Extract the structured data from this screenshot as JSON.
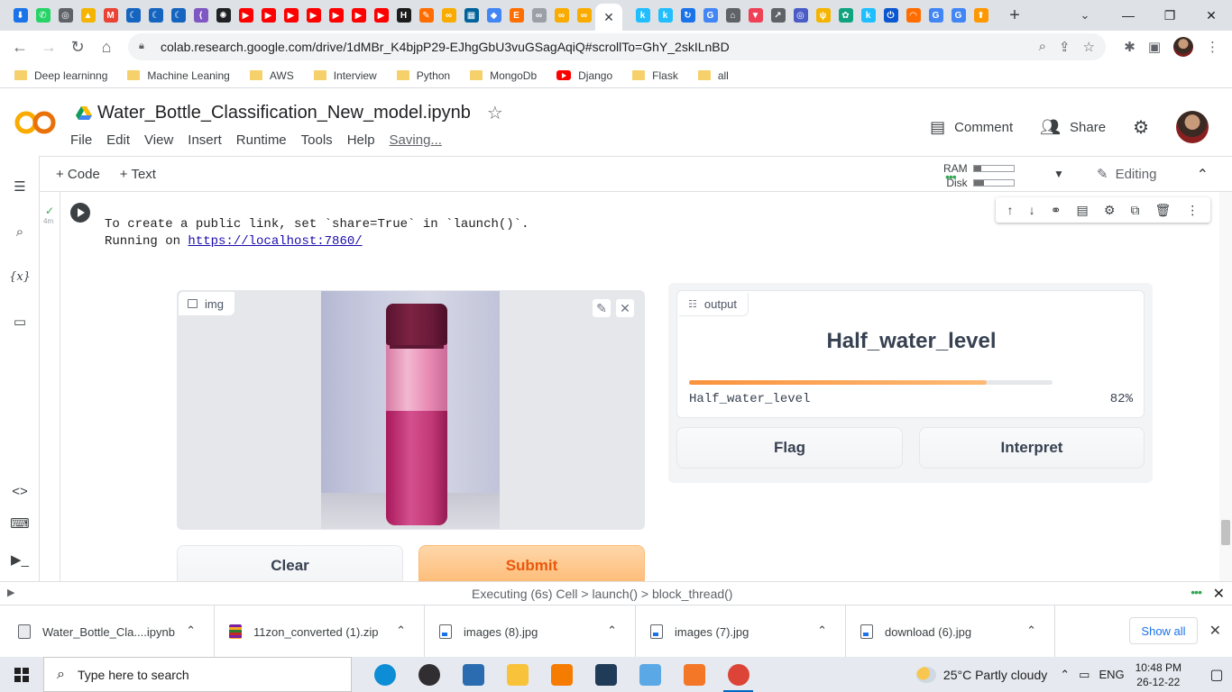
{
  "browser": {
    "tab_favicons": [
      {
        "name": "download-icon",
        "color": "#1a73e8",
        "glyph": "⬇"
      },
      {
        "name": "whatsapp-icon",
        "color": "#25d366",
        "glyph": "✆"
      },
      {
        "name": "globe-icon",
        "color": "#5f6368",
        "glyph": "◎"
      },
      {
        "name": "drive-icon",
        "color": "#f4b400",
        "glyph": "▲"
      },
      {
        "name": "gmail-icon",
        "color": "#ea4335",
        "glyph": "M"
      },
      {
        "name": "moon-icon",
        "color": "#1565c0",
        "glyph": "☾"
      },
      {
        "name": "moon-icon",
        "color": "#1565c0",
        "glyph": "☾"
      },
      {
        "name": "moon-icon",
        "color": "#1565c0",
        "glyph": "☾"
      },
      {
        "name": "vscode-icon",
        "color": "#7e57c2",
        "glyph": "⟨"
      },
      {
        "name": "openai-icon",
        "color": "#202124",
        "glyph": "✺"
      },
      {
        "name": "youtube-icon",
        "color": "#ff0000",
        "glyph": "▶"
      },
      {
        "name": "youtube-icon",
        "color": "#ff0000",
        "glyph": "▶"
      },
      {
        "name": "youtube-icon",
        "color": "#ff0000",
        "glyph": "▶"
      },
      {
        "name": "youtube-icon",
        "color": "#ff0000",
        "glyph": "▶"
      },
      {
        "name": "youtube-icon",
        "color": "#ff0000",
        "glyph": "▶"
      },
      {
        "name": "youtube-icon",
        "color": "#ff0000",
        "glyph": "▶"
      },
      {
        "name": "youtube-icon",
        "color": "#ff0000",
        "glyph": "▶"
      },
      {
        "name": "hackerrank-icon",
        "color": "#1c1c1c",
        "glyph": "H"
      },
      {
        "name": "pen-icon",
        "color": "#ff6d00",
        "glyph": "✎"
      },
      {
        "name": "colab-icon",
        "color": "#f9ab00",
        "glyph": "∞"
      },
      {
        "name": "ieee-icon",
        "color": "#00629b",
        "glyph": "▦"
      },
      {
        "name": "diamond-icon",
        "color": "#4285f4",
        "glyph": "◆"
      },
      {
        "name": "edureka-icon",
        "color": "#ff6f00",
        "glyph": "E"
      },
      {
        "name": "link-icon",
        "color": "#9aa0a6",
        "glyph": "∞"
      },
      {
        "name": "colab-icon",
        "color": "#f9ab00",
        "glyph": "∞"
      },
      {
        "name": "colab-icon",
        "color": "#f9ab00",
        "glyph": "∞"
      }
    ],
    "active_tab_close": "✕",
    "tab_favicons_right": [
      {
        "name": "kaggle-icon",
        "color": "#20beff",
        "glyph": "k"
      },
      {
        "name": "kaggle-icon",
        "color": "#20beff",
        "glyph": "k"
      },
      {
        "name": "refresh-site-icon",
        "color": "#1a73e8",
        "glyph": "↻"
      },
      {
        "name": "google-icon",
        "color": "#4285f4",
        "glyph": "G"
      },
      {
        "name": "site-icon",
        "color": "#5f6368",
        "glyph": "⌂"
      },
      {
        "name": "pocket-icon",
        "color": "#ef4056",
        "glyph": "▼"
      },
      {
        "name": "chart-icon",
        "color": "#5f6368",
        "glyph": "↗"
      },
      {
        "name": "target-icon",
        "color": "#4a5cc5",
        "glyph": "◎"
      },
      {
        "name": "fork-icon",
        "color": "#f4b400",
        "glyph": "ψ"
      },
      {
        "name": "chatgpt-icon",
        "color": "#10a37f",
        "glyph": "✿"
      },
      {
        "name": "kaggle-icon",
        "color": "#20beff",
        "glyph": "k"
      },
      {
        "name": "power-icon",
        "color": "#0b57d0",
        "glyph": "⏻"
      },
      {
        "name": "loader-icon",
        "color": "#ff6d00",
        "glyph": "◠"
      },
      {
        "name": "google-icon",
        "color": "#4285f4",
        "glyph": "G"
      },
      {
        "name": "google-icon",
        "color": "#4285f4",
        "glyph": "G"
      },
      {
        "name": "upload-icon",
        "color": "#ff9800",
        "glyph": "⬆"
      }
    ],
    "new_tab": "+",
    "url": "colab.research.google.com/drive/1dMBr_K4bjpP29-EJhgGbU3vuGSagAqiQ#scrollTo=GhY_2skILnBD",
    "bookmarks": [
      {
        "label": "Deep learninng",
        "type": "folder"
      },
      {
        "label": "Machine Leaning",
        "type": "folder"
      },
      {
        "label": "AWS",
        "type": "folder"
      },
      {
        "label": "Interview",
        "type": "folder"
      },
      {
        "label": "Python",
        "type": "folder"
      },
      {
        "label": "MongoDb",
        "type": "folder"
      },
      {
        "label": "Django",
        "type": "youtube"
      },
      {
        "label": "Flask",
        "type": "folder"
      },
      {
        "label": "all",
        "type": "folder"
      }
    ]
  },
  "colab": {
    "notebook_title": "Water_Bottle_Classification_New_model.ipynb",
    "menu": [
      "File",
      "Edit",
      "View",
      "Insert",
      "Runtime",
      "Tools",
      "Help"
    ],
    "saving": "Saving...",
    "comment_label": "Comment",
    "share_label": "Share",
    "add_code": "+ Code",
    "add_text": "+ Text",
    "ram_label": "RAM",
    "disk_label": "Disk",
    "ram_usage": 0.2,
    "disk_usage": 0.25,
    "editing_label": "Editing",
    "cell_time": "4m",
    "output_line1": "To create a public link, set `share=True` in `launch()`.",
    "output_line2_prefix": "Running on ",
    "output_link": "https://localhost:7860/"
  },
  "gradio": {
    "input_label": "img",
    "output_label": "output",
    "prediction": "Half_water_level",
    "confidences": [
      {
        "label": "Half_water_level",
        "value": 0.82,
        "display": "82%"
      }
    ],
    "flag_label": "Flag",
    "interpret_label": "Interpret",
    "clear_label": "Clear",
    "submit_label": "Submit"
  },
  "status": {
    "text": "Executing (6s)   Cell > launch() > block_thread()"
  },
  "downloads": {
    "items": [
      {
        "name": "Water_Bottle_Cla....ipynb",
        "icon": "notebook-file-icon"
      },
      {
        "name": "11zon_converted (1).zip",
        "icon": "zip-file-icon"
      },
      {
        "name": "images (8).jpg",
        "icon": "image-file-icon"
      },
      {
        "name": "images (7).jpg",
        "icon": "image-file-icon"
      },
      {
        "name": "download (6).jpg",
        "icon": "image-file-icon"
      }
    ],
    "show_all": "Show all"
  },
  "taskbar": {
    "search_placeholder": "Type here to search",
    "apps": [
      {
        "name": "edge-icon",
        "color": "#0c8dd6"
      },
      {
        "name": "obs-icon",
        "color": "#302e31"
      },
      {
        "name": "remote-desktop-icon",
        "color": "#2b6cb0"
      },
      {
        "name": "file-explorer-icon",
        "color": "#f8c23a"
      },
      {
        "name": "vlc-icon",
        "color": "#f57c00"
      },
      {
        "name": "pycharm-icon",
        "color": "#1f3b57"
      },
      {
        "name": "snowflake-app-icon",
        "color": "#5aa9e6"
      },
      {
        "name": "jupyter-icon",
        "color": "#f37726"
      },
      {
        "name": "chrome-icon",
        "color": "#db4437"
      }
    ],
    "weather": "25°C  Partly cloudy",
    "language": "ENG",
    "time": "10:48 PM",
    "date": "26-12-22"
  }
}
